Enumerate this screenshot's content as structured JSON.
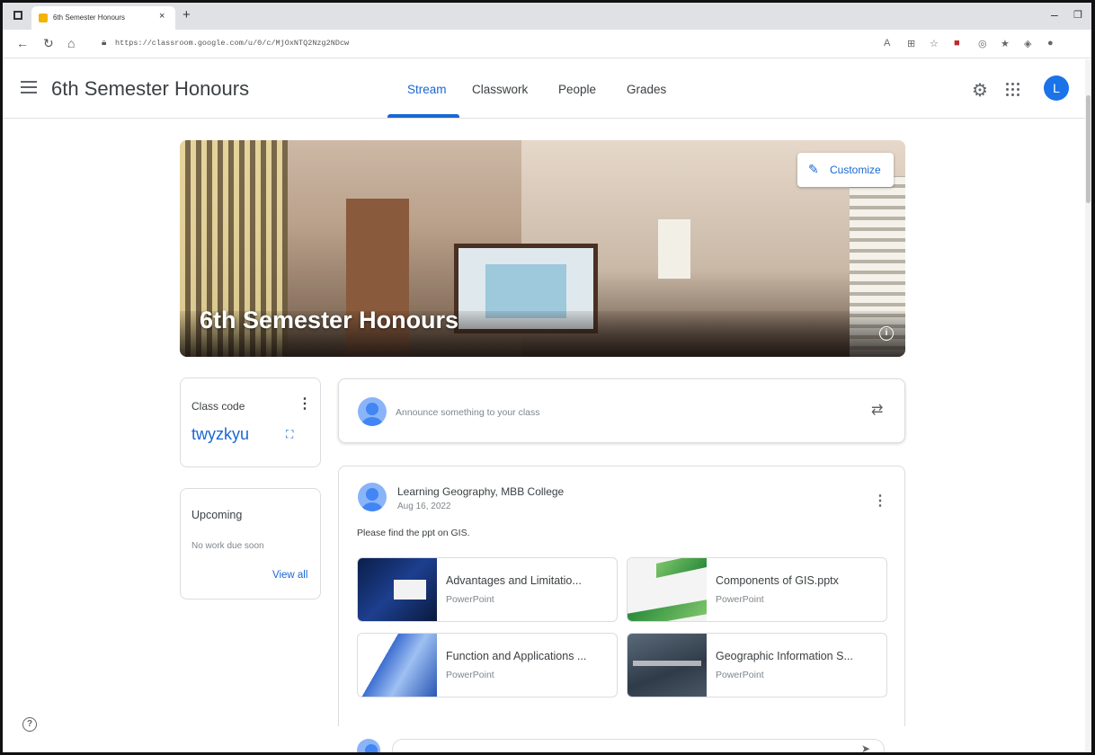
{
  "browser": {
    "tab_title": "6th Semester Honours",
    "tab_close": "×",
    "new_tab": "+",
    "url": "https://classroom.google.com/u/0/c/MjOxNTQ2Nzg2NDcw",
    "minimize": "–",
    "restore": "❐"
  },
  "header": {
    "class_title": "6th Semester Honours",
    "tabs": [
      {
        "label": "Stream",
        "active": true
      },
      {
        "label": "Classwork"
      },
      {
        "label": "People"
      },
      {
        "label": "Grades"
      }
    ],
    "avatar_letter": "L",
    "colors": {
      "accent": "#1967d2",
      "avatar": "#1a73e8"
    }
  },
  "banner": {
    "title": "6th Semester Honours",
    "customize_label": "Customize",
    "info_glyph": "i"
  },
  "class_code": {
    "label": "Class code",
    "code": "twyzkyu"
  },
  "upcoming": {
    "title": "Upcoming",
    "empty_text": "No work due soon",
    "view_all": "View all"
  },
  "announce": {
    "placeholder": "Announce something to your class"
  },
  "post": {
    "author": "Learning Geography, MBB College",
    "date": "Aug 16, 2022",
    "body": "Please find the ppt on GIS.",
    "attachments": [
      {
        "name": "Advantages and Limitatio...",
        "kind": "PowerPoint"
      },
      {
        "name": "Components of GIS.pptx",
        "kind": "PowerPoint"
      },
      {
        "name": "Function and Applications ...",
        "kind": "PowerPoint"
      },
      {
        "name": "Geographic Information S...",
        "kind": "PowerPoint"
      }
    ]
  },
  "help_glyph": "?"
}
